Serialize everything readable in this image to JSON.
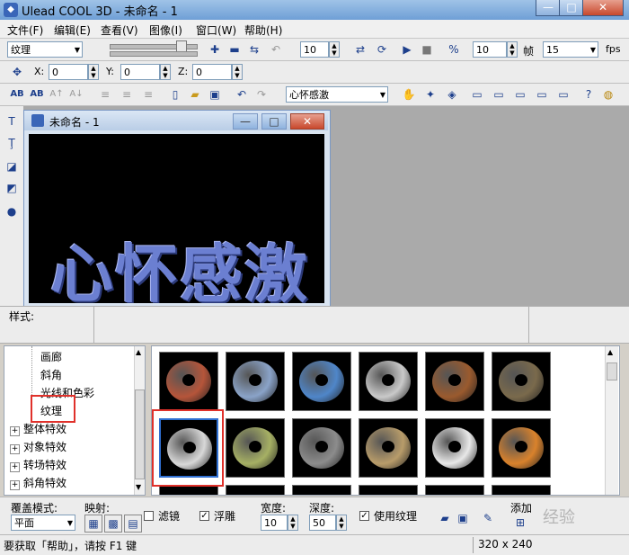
{
  "app": {
    "title": "Ulead COOL 3D - 未命名 - 1",
    "window_controls": {
      "minimize": "—",
      "maximize": "□",
      "close": "✕"
    }
  },
  "menu": [
    "文件(F)",
    "编辑(E)",
    "查看(V)",
    "图像(I)",
    "窗口(W)",
    "帮助(H)"
  ],
  "toolbar1": {
    "mode_select": "纹理",
    "frame_value": "10",
    "frames_value": "10",
    "frames_label": "帧",
    "fps_value": "15",
    "fps_label": "fps"
  },
  "toolbar2": {
    "x_label": "X:",
    "x_value": "0",
    "y_label": "Y:",
    "y_value": "0",
    "z_label": "Z:",
    "z_value": "0"
  },
  "toolbar3": {
    "text_object_select": "心怀感激"
  },
  "child_window": {
    "title": "未命名 - 1",
    "canvas_text": "心怀感激"
  },
  "style_strip": {
    "label": "样式:"
  },
  "tree": {
    "items": [
      {
        "label": "画廊",
        "indent": 2,
        "expander": false
      },
      {
        "label": "斜角",
        "indent": 2,
        "expander": false
      },
      {
        "label": "光线和色彩",
        "indent": 2,
        "expander": false
      },
      {
        "label": "纹理",
        "indent": 2,
        "expander": false
      },
      {
        "label": "整体特效",
        "indent": 0,
        "expander": true
      },
      {
        "label": "对象特效",
        "indent": 0,
        "expander": true
      },
      {
        "label": "转场特效",
        "indent": 0,
        "expander": true
      },
      {
        "label": "斜角特效",
        "indent": 0,
        "expander": true
      }
    ]
  },
  "thumbnails": [
    {
      "name": "brick",
      "color": "#b5553a"
    },
    {
      "name": "blue-white-pattern",
      "color": "#8aa3c8"
    },
    {
      "name": "blue-stone",
      "color": "#4f86c9"
    },
    {
      "name": "white-brick",
      "color": "#c9c9c9"
    },
    {
      "name": "wood-rust",
      "color": "#9a5a2e"
    },
    {
      "name": "brown-rock",
      "color": "#7a6a4c"
    },
    {
      "name": "marble-white",
      "color": "#d8d8d8"
    },
    {
      "name": "green-lichen",
      "color": "#a6b064"
    },
    {
      "name": "grey-granite",
      "color": "#8c8c8c"
    },
    {
      "name": "beige-weave",
      "color": "#b89c6a"
    },
    {
      "name": "chrome",
      "color": "#e8e8e8"
    },
    {
      "name": "orange-plastic",
      "color": "#d9822c"
    }
  ],
  "props": {
    "cover_mode_label": "覆盖模式:",
    "cover_mode_value": "平面",
    "mapping_label": "映射:",
    "filter_label": "滤镜",
    "emboss_label": "浮雕",
    "width_label": "宽度:",
    "width_value": "10",
    "depth_label": "深度:",
    "depth_value": "50",
    "use_texture_label": "使用纹理",
    "add_label": "添加"
  },
  "status": {
    "help": "要获取「帮助」，请按 F1 键",
    "size": "320 x 240"
  },
  "watermark": "经验"
}
